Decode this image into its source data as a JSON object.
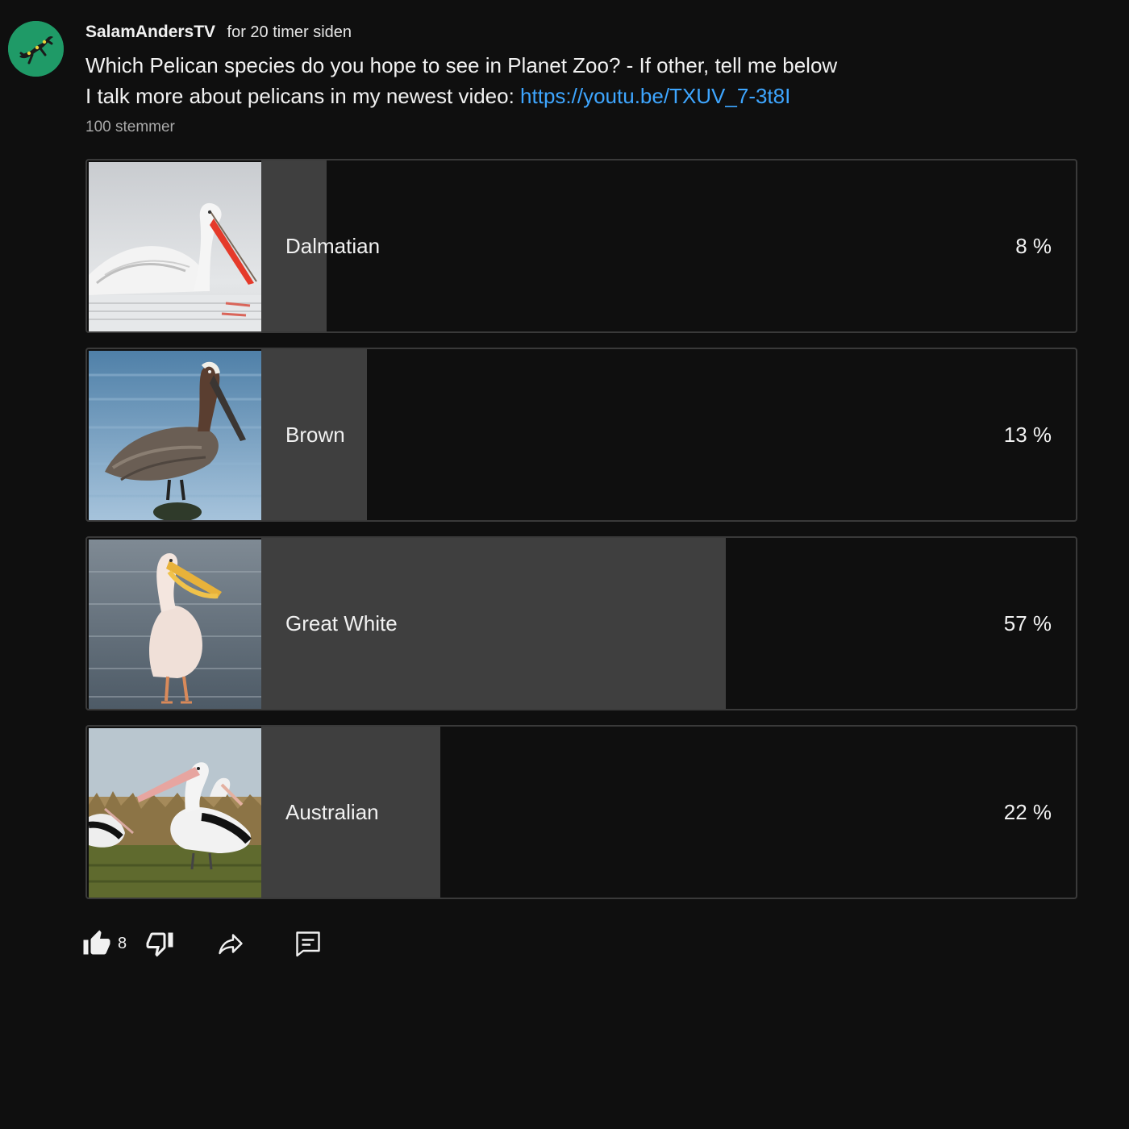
{
  "post": {
    "channel_name": "SalamAndersTV",
    "time_ago": "for 20 timer siden",
    "text_line1": "Which Pelican species do you hope to see in Planet Zoo? - If other, tell me below",
    "text_line2_prefix": "I talk more about pelicans in my newest video: ",
    "link_text": "https://youtu.be/TXUV_7-3t8I",
    "votes_label": "100 stemmer"
  },
  "poll": {
    "options": [
      {
        "label": "Dalmatian",
        "percent_label": "8 %",
        "percent": 8,
        "image": "dalmatian-pelican"
      },
      {
        "label": "Brown",
        "percent_label": "13 %",
        "percent": 13,
        "image": "brown-pelican"
      },
      {
        "label": "Great White",
        "percent_label": "57 %",
        "percent": 57,
        "image": "great-white-pelican"
      },
      {
        "label": "Australian",
        "percent_label": "22 %",
        "percent": 22,
        "image": "australian-pelican"
      }
    ]
  },
  "actions": {
    "like_count": "8",
    "like_icon": "thumb-up-icon",
    "dislike_icon": "thumb-down-icon",
    "share_icon": "share-icon",
    "comment_icon": "comment-icon"
  },
  "colors": {
    "background": "#0f0f0f",
    "bar_fill": "#3f3f3f",
    "link": "#3ea6ff",
    "avatar": "#1f9a67"
  }
}
